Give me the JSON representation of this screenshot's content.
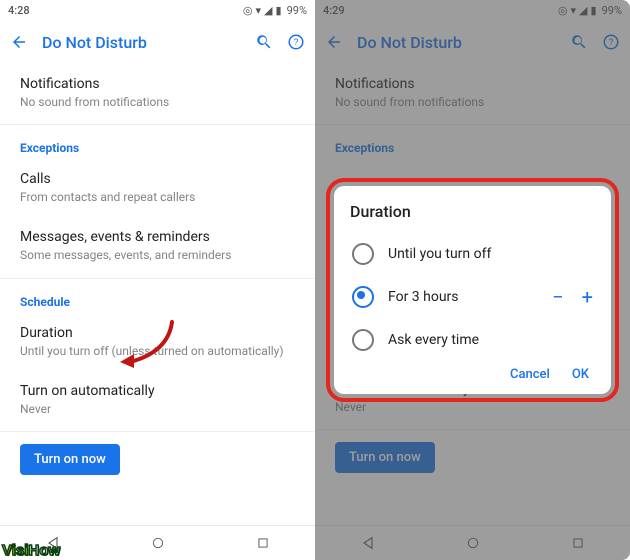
{
  "left": {
    "time": "4:28",
    "battery": "99%",
    "title": "Do Not Disturb",
    "notifications": {
      "title": "Notifications",
      "sub": "No sound from notifications"
    },
    "exceptions_header": "Exceptions",
    "calls": {
      "title": "Calls",
      "sub": "From contacts and repeat callers"
    },
    "msgs": {
      "title": "Messages, events & reminders",
      "sub": "Some messages, events, and reminders"
    },
    "schedule_header": "Schedule",
    "duration": {
      "title": "Duration",
      "sub": "Until you turn off (unless turned on automatically)"
    },
    "auto": {
      "title": "Turn on automatically",
      "sub": "Never"
    },
    "turn_on": "Turn on now"
  },
  "right": {
    "time": "4:29",
    "battery": "99%",
    "title": "Do Not Disturb",
    "notifications": {
      "title": "Notifications",
      "sub": "No sound from notifications"
    },
    "exceptions_header": "Exceptions",
    "auto": {
      "title": "Turn on automatically",
      "sub": "Never"
    },
    "turn_on": "Turn on now",
    "dialog": {
      "title": "Duration",
      "opt1": "Until you turn off",
      "opt2": "For 3 hours",
      "opt3": "Ask every time",
      "cancel": "Cancel",
      "ok": "OK"
    }
  },
  "watermark": {
    "a": "Visi",
    "b": "How"
  }
}
